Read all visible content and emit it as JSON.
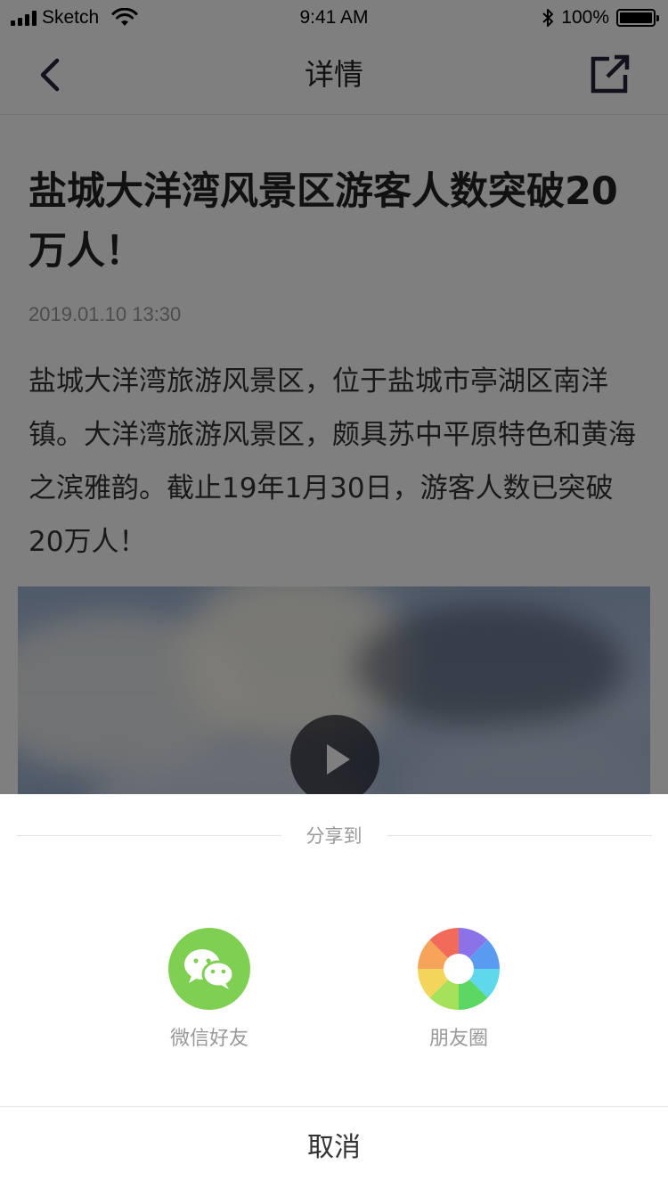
{
  "status_bar": {
    "carrier": "Sketch",
    "time": "9:41 AM",
    "battery_percent": "100%",
    "battery_level": 1.0
  },
  "nav": {
    "title": "详情",
    "back_icon": "chevron-left-icon",
    "share_icon": "external-share-icon"
  },
  "article": {
    "title": "盐城大洋湾风景区游客人数突破20万人！",
    "date": "2019.01.10 13:30",
    "body": "盐城大洋湾旅游风景区，位于盐城市亭湖区南洋镇。大洋湾旅游风景区，颇具苏中平原特色和黄海之滨雅韵。截止19年1月30日，游客人数已突破20万人！",
    "video_icon": "play-icon"
  },
  "share_sheet": {
    "title": "分享到",
    "options": [
      {
        "label": "微信好友",
        "icon": "wechat-icon",
        "color": "#7ecf52"
      },
      {
        "label": "朋友圈",
        "icon": "moments-icon"
      }
    ],
    "cancel_label": "取消"
  },
  "colors": {
    "overlay": "rgba(0,0,0,0.5)",
    "wechat_green": "#7ecf52",
    "text_primary": "#222222",
    "text_muted": "#999999"
  }
}
